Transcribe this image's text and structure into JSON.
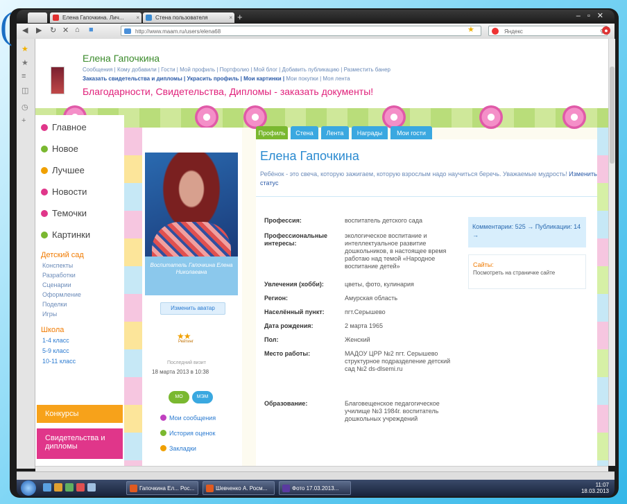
{
  "browser": {
    "tabs": [
      {
        "label": "Елена Гапочкина. Лич...",
        "color": "#e03030"
      },
      {
        "label": "Стена пользователя",
        "color": "#3a8ad0"
      }
    ],
    "address": "http://www.maam.ru/users/elena68",
    "search_placeholder": "Яндекс"
  },
  "header": {
    "user_name": "Елена Гапочкина",
    "links_row1": "Сообщения | Кому добавили | Гости | Мой профиль | Портфолио | Мой блог | Добавить публикацию | Разместить банер",
    "links_row2_bold": "Заказать свидетельства и дипломы | Украсить профиль | Мои картинки |",
    "links_row2_normal": " Мои покупки | Моя лента",
    "promo": "Благодарности, Свидетельства, Дипломы - заказать документы!"
  },
  "left_menu": {
    "items": [
      {
        "label": "Главное",
        "color": "#e0368a"
      },
      {
        "label": "Новое",
        "color": "#7ab830"
      },
      {
        "label": "Лучшее",
        "color": "#f0a000"
      },
      {
        "label": "Новости",
        "color": "#e0368a"
      },
      {
        "label": "Темочки",
        "color": "#e0368a"
      },
      {
        "label": "Картинки",
        "color": "#7ab830"
      }
    ],
    "section1_title": "Детский сад",
    "section1_items": [
      "Конспекты",
      "Разработки",
      "Сценарии",
      "Оформление",
      "Поделки",
      "Игры"
    ],
    "section2_title": "Школа",
    "section2_items": [
      "1-4 класс",
      "5-9 класс",
      "10-11 класс"
    ],
    "contests": "Конкурсы",
    "diplomas": "Свидетельства и дипломы"
  },
  "profile_col": {
    "photo_caption": "Воспитатель Гапочкина Елена Николаевна",
    "change_avatar": "Изменить аватар",
    "stars": "★★",
    "stars_caption": "Рейтинг",
    "last_visit_label": "Последний визит",
    "last_visit": "18 марта 2013 в 10:38",
    "pills": [
      {
        "label": "МО",
        "color": "#7ab830"
      },
      {
        "label": "МЭМ",
        "color": "#3aa8e0"
      }
    ],
    "links": [
      {
        "label": "Мои сообщения",
        "color": "#c040c0"
      },
      {
        "label": "История оценок",
        "color": "#7ab830"
      },
      {
        "label": "Закладки",
        "color": "#f0a000"
      }
    ]
  },
  "main": {
    "tabs": [
      {
        "label": "Профиль",
        "color": "#7ab830"
      },
      {
        "label": "Стена",
        "color": "#3aa8e0"
      },
      {
        "label": "Лента",
        "color": "#3aa8e0"
      },
      {
        "label": "Награды",
        "color": "#3aa8e0"
      },
      {
        "label": "Мои гости",
        "color": "#3aa8e0"
      }
    ],
    "title": "Елена Гапочкина",
    "status": "Ребёнок - это свеча, которую зажигаем, которую взрослым надо научиться беречь. Уважаемые мудрость!",
    "status_link": "Изменить статус",
    "fields": [
      {
        "label": "Профессия:",
        "value": "воспитатель детского сада"
      },
      {
        "label": "Профессиональные интересы:",
        "value": "экологическое воспитание и интеллектуальное развитие дошкольников, в настоящее время работаю над темой «Народное воспитание детей»"
      },
      {
        "label": "Увлечения (хобби):",
        "value": "цветы, фото, кулинария"
      },
      {
        "label": "Регион:",
        "value": "Амурская область"
      },
      {
        "label": "Населённый пункт:",
        "value": "пгт.Серышево"
      },
      {
        "label": "Дата рождения:",
        "value": "2 марта 1965"
      },
      {
        "label": "Пол:",
        "value": "Женский"
      },
      {
        "label": "Место работы:",
        "value": "МАДОУ ЦРР №2 пгт. Серышево структурное подразделение детский сад №2 ds-dlsemi.ru"
      },
      {
        "label": "Образование:",
        "value": "Благовещенское педагогическое училище №3 1984г. воспитатель дошкольных учреждений"
      }
    ],
    "stats": "Комментарии: 525 → Публикации: 14 →",
    "sites_title": "Сайты:",
    "sites_text": "Посмотреть на страничке сайте"
  },
  "taskbar": {
    "tasks": [
      {
        "label": "Гапочкина Ел... Рос...",
        "color": "#e05a20"
      },
      {
        "label": "Шевченко А. Росм...",
        "color": "#e05a20"
      },
      {
        "label": "Фото 17.03.2013...",
        "color": "#5a3aa0"
      }
    ],
    "time": "11:07",
    "date": "18.03.2013"
  }
}
